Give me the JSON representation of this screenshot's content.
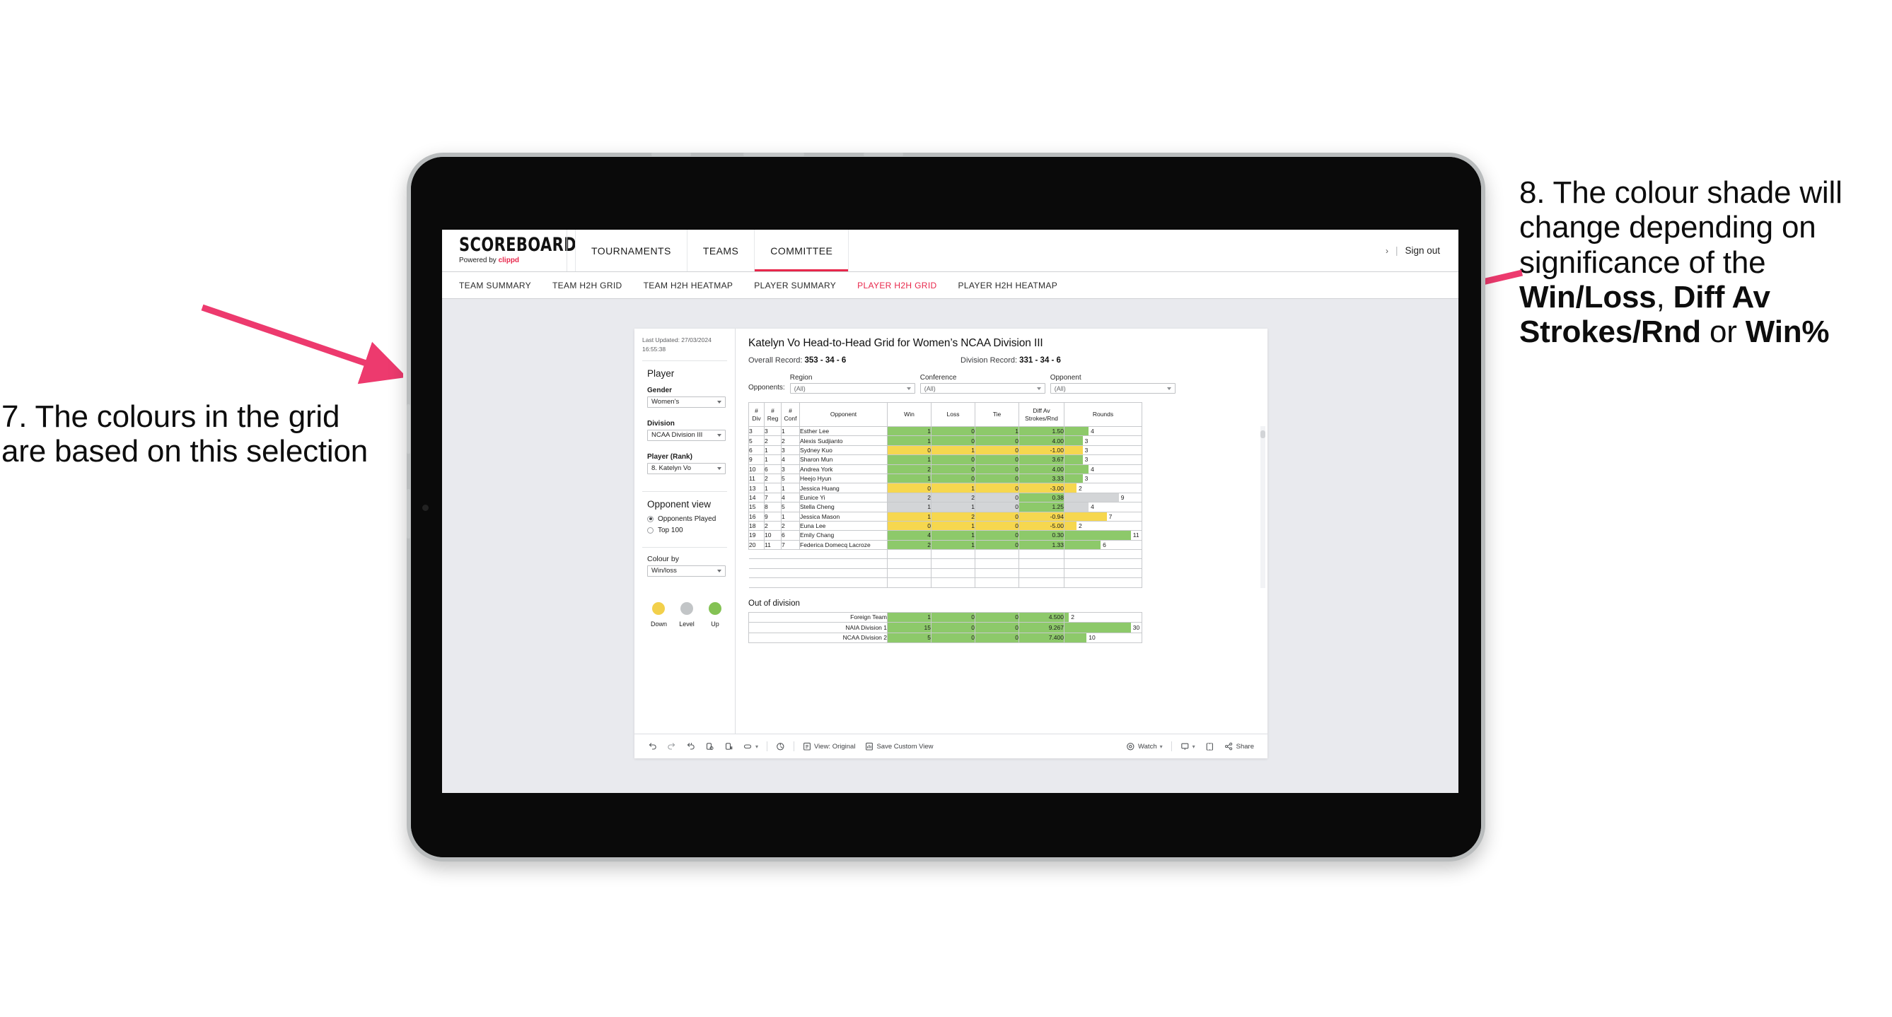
{
  "annotations": {
    "left": "7. The colours in the grid are based on this selection",
    "right_lead": "8. The colour shade will change depending on significance of the ",
    "right_b1": "Win/Loss",
    "right_mid1": ", ",
    "right_b2": "Diff Av Strokes/Rnd",
    "right_mid2": " or ",
    "right_b3": "Win%",
    "arrow_color": "#ED3A6E"
  },
  "header": {
    "logo_word": "SCOREBOARD",
    "logo_powered": "Powered by ",
    "logo_brand": "clippd",
    "nav": [
      {
        "label": "TOURNAMENTS",
        "active": false
      },
      {
        "label": "TEAMS",
        "active": false
      },
      {
        "label": "COMMITTEE",
        "active": true
      }
    ],
    "chevron": "›",
    "divider": "|",
    "sign_out": "Sign out"
  },
  "subnav": [
    {
      "label": "TEAM SUMMARY",
      "active": false
    },
    {
      "label": "TEAM H2H GRID",
      "active": false
    },
    {
      "label": "TEAM H2H HEATMAP",
      "active": false
    },
    {
      "label": "PLAYER SUMMARY",
      "active": false
    },
    {
      "label": "PLAYER H2H GRID",
      "active": true
    },
    {
      "label": "PLAYER H2H HEATMAP",
      "active": false
    }
  ],
  "sidebar": {
    "last_updated_line1": "Last Updated: 27/03/2024",
    "last_updated_line2": "16:55:38",
    "player_heading": "Player",
    "gender_label": "Gender",
    "gender_value": "Women’s",
    "division_label": "Division",
    "division_value": "NCAA Division III",
    "player_rank_label": "Player (Rank)",
    "player_rank_value": "8. Katelyn Vo",
    "opponent_view_heading": "Opponent view",
    "opponent_view_options": [
      {
        "label": "Opponents Played",
        "selected": true
      },
      {
        "label": "Top 100",
        "selected": false
      }
    ],
    "colour_by_label": "Colour by",
    "colour_by_value": "Win/loss",
    "legend": [
      {
        "label": "Down",
        "color": "#F2D04B"
      },
      {
        "label": "Level",
        "color": "#C2C5C7"
      },
      {
        "label": "Up",
        "color": "#84C254"
      }
    ]
  },
  "viz": {
    "title": "Katelyn Vo Head-to-Head Grid for Women’s NCAA Division III",
    "overall_record_label": "Overall Record: ",
    "overall_record_value": "353 - 34 - 6",
    "division_record_label": "Division Record: ",
    "division_record_value": "331 - 34 - 6",
    "opponents_label": "Opponents:",
    "filters": [
      {
        "caption": "Region",
        "value": "(All)"
      },
      {
        "caption": "Conference",
        "value": "(All)"
      },
      {
        "caption": "Opponent",
        "value": "(All)"
      }
    ],
    "out_of_division_title": "Out of division"
  },
  "chart_data": {
    "type": "table",
    "title": "Katelyn Vo Head-to-Head Grid for Women’s NCAA Division III",
    "columns": [
      "# Div",
      "# Reg",
      "# Conf",
      "Opponent",
      "Win",
      "Loss",
      "Tie",
      "Diff Av Strokes/Rnd",
      "Rounds"
    ],
    "column_header_lines": [
      [
        "#",
        "Div"
      ],
      [
        "#",
        "Reg"
      ],
      [
        "#",
        "Conf"
      ],
      [
        "Opponent"
      ],
      [
        "Win"
      ],
      [
        "Loss"
      ],
      [
        "Tie"
      ],
      [
        "Diff Av",
        "Strokes/Rnd"
      ],
      [
        "Rounds"
      ]
    ],
    "colour_scale": {
      "up": "#8DC96A",
      "level": "#D3D5D7",
      "down": "#F6D74F"
    },
    "rounds_max": 11,
    "rows": [
      {
        "div": "3",
        "reg": "3",
        "conf": "1",
        "opponent": "Esther Lee",
        "win": "1",
        "loss": "0",
        "tie": "1",
        "diff": "1.50",
        "rounds": "4",
        "rounds_n": 4,
        "tone": "up"
      },
      {
        "div": "5",
        "reg": "2",
        "conf": "2",
        "opponent": "Alexis Sudjianto",
        "win": "1",
        "loss": "0",
        "tie": "0",
        "diff": "4.00",
        "rounds": "3",
        "rounds_n": 3,
        "tone": "up"
      },
      {
        "div": "6",
        "reg": "1",
        "conf": "3",
        "opponent": "Sydney Kuo",
        "win": "0",
        "loss": "1",
        "tie": "0",
        "diff": "-1.00",
        "rounds": "3",
        "rounds_n": 3,
        "tone": "down"
      },
      {
        "div": "9",
        "reg": "1",
        "conf": "4",
        "opponent": "Sharon Mun",
        "win": "1",
        "loss": "0",
        "tie": "0",
        "diff": "3.67",
        "rounds": "3",
        "rounds_n": 3,
        "tone": "up"
      },
      {
        "div": "10",
        "reg": "6",
        "conf": "3",
        "opponent": "Andrea York",
        "win": "2",
        "loss": "0",
        "tie": "0",
        "diff": "4.00",
        "rounds": "4",
        "rounds_n": 4,
        "tone": "up"
      },
      {
        "div": "11",
        "reg": "2",
        "conf": "5",
        "opponent": "Heejo Hyun",
        "win": "1",
        "loss": "0",
        "tie": "0",
        "diff": "3.33",
        "rounds": "3",
        "rounds_n": 3,
        "tone": "up"
      },
      {
        "div": "13",
        "reg": "1",
        "conf": "1",
        "opponent": "Jessica Huang",
        "win": "0",
        "loss": "1",
        "tie": "0",
        "diff": "-3.00",
        "rounds": "2",
        "rounds_n": 2,
        "tone": "down"
      },
      {
        "div": "14",
        "reg": "7",
        "conf": "4",
        "opponent": "Eunice Yi",
        "win": "2",
        "loss": "2",
        "tie": "0",
        "diff": "0.38",
        "rounds": "9",
        "rounds_n": 9,
        "tone": "level",
        "diff_tone": "up"
      },
      {
        "div": "15",
        "reg": "8",
        "conf": "5",
        "opponent": "Stella Cheng",
        "win": "1",
        "loss": "1",
        "tie": "0",
        "diff": "1.25",
        "rounds": "4",
        "rounds_n": 4,
        "tone": "level",
        "diff_tone": "up"
      },
      {
        "div": "16",
        "reg": "9",
        "conf": "1",
        "opponent": "Jessica Mason",
        "win": "1",
        "loss": "2",
        "tie": "0",
        "diff": "-0.94",
        "rounds": "7",
        "rounds_n": 7,
        "tone": "down"
      },
      {
        "div": "18",
        "reg": "2",
        "conf": "2",
        "opponent": "Euna Lee",
        "win": "0",
        "loss": "1",
        "tie": "0",
        "diff": "-5.00",
        "rounds": "2",
        "rounds_n": 2,
        "tone": "down"
      },
      {
        "div": "19",
        "reg": "10",
        "conf": "6",
        "opponent": "Emily Chang",
        "win": "4",
        "loss": "1",
        "tie": "0",
        "diff": "0.30",
        "rounds": "11",
        "rounds_n": 11,
        "tone": "up"
      },
      {
        "div": "20",
        "reg": "11",
        "conf": "7",
        "opponent": "Federica Domecq Lacroze",
        "win": "2",
        "loss": "1",
        "tie": "0",
        "diff": "1.33",
        "rounds": "6",
        "rounds_n": 6,
        "tone": "up"
      }
    ],
    "out_of_division": {
      "rounds_max": 30,
      "rows": [
        {
          "name": "Foreign Team",
          "win": "1",
          "loss": "0",
          "tie": "0",
          "diff": "4.500",
          "rounds": "2",
          "rounds_n": 2,
          "tone": "up"
        },
        {
          "name": "NAIA Division 1",
          "win": "15",
          "loss": "0",
          "tie": "0",
          "diff": "9.267",
          "rounds": "30",
          "rounds_n": 30,
          "tone": "up"
        },
        {
          "name": "NCAA Division 2",
          "win": "5",
          "loss": "0",
          "tie": "0",
          "diff": "7.400",
          "rounds": "10",
          "rounds_n": 10,
          "tone": "up"
        }
      ]
    }
  },
  "toolbar": {
    "view_original": "View: Original",
    "save_custom_view": "Save Custom View",
    "watch": "Watch",
    "share": "Share",
    "caret": "▾"
  }
}
